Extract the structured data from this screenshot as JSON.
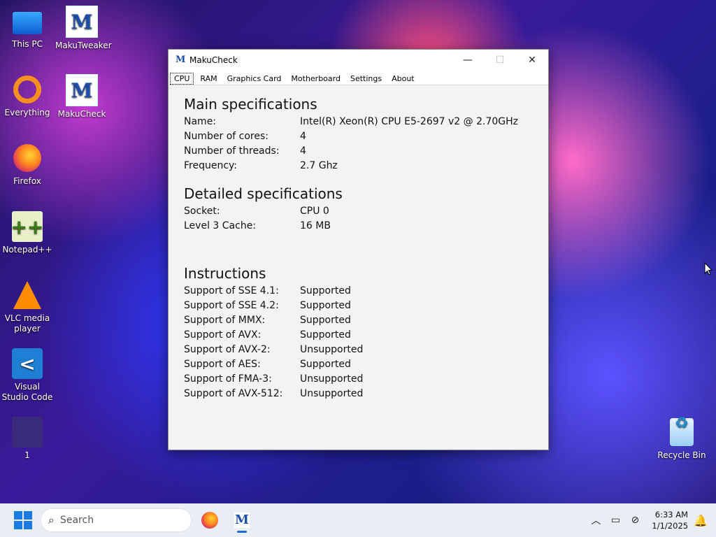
{
  "desktop": {
    "icons": [
      {
        "label": "This PC",
        "icon": "computer-icon"
      },
      {
        "label": "MakuTweaker",
        "icon": "makutweaker-icon"
      },
      {
        "label": "Everything",
        "icon": "everything-search-icon"
      },
      {
        "label": "MakuCheck",
        "icon": "makucheck-icon"
      },
      {
        "label": "Firefox",
        "icon": "firefox-icon"
      },
      {
        "label": "Notepad++",
        "icon": "notepadpp-icon"
      },
      {
        "label": "VLC media player",
        "icon": "vlc-icon"
      },
      {
        "label": "Visual Studio Code",
        "icon": "vscode-icon"
      },
      {
        "label": "1",
        "icon": "image-file-icon"
      },
      {
        "label": "Recycle Bin",
        "icon": "recycle-bin-icon"
      }
    ]
  },
  "window": {
    "title": "MakuCheck",
    "tabs": [
      "CPU",
      "RAM",
      "Graphics Card",
      "Motherboard",
      "Settings",
      "About"
    ],
    "active_tab": "CPU",
    "main": {
      "title": "Main specifications",
      "rows": [
        {
          "k": "Name:",
          "v": "Intel(R) Xeon(R) CPU E5-2697 v2 @ 2.70GHz"
        },
        {
          "k": "Number of cores:",
          "v": "4"
        },
        {
          "k": "Number of threads:",
          "v": "4"
        },
        {
          "k": "Frequency:",
          "v": "2.7 Ghz"
        }
      ]
    },
    "detailed": {
      "title": "Detailed specifications",
      "rows": [
        {
          "k": "Socket:",
          "v": "CPU 0"
        },
        {
          "k": "Level 3 Cache:",
          "v": "16 MB"
        }
      ]
    },
    "instructions": {
      "title": "Instructions",
      "rows": [
        {
          "k": "Support of SSE 4.1:",
          "v": "Supported"
        },
        {
          "k": "Support of SSE 4.2:",
          "v": "Supported"
        },
        {
          "k": "Support of MMX:",
          "v": "Supported"
        },
        {
          "k": "Support of AVX:",
          "v": "Supported"
        },
        {
          "k": "Support of AVX-2:",
          "v": "Unsupported"
        },
        {
          "k": "Support of AES:",
          "v": "Supported"
        },
        {
          "k": "Support of FMA-3:",
          "v": "Unsupported"
        },
        {
          "k": "Support of AVX-512:",
          "v": "Unsupported"
        }
      ]
    }
  },
  "taskbar": {
    "search_placeholder": "Search",
    "time": "6:33 AM",
    "date": "1/1/2025"
  }
}
